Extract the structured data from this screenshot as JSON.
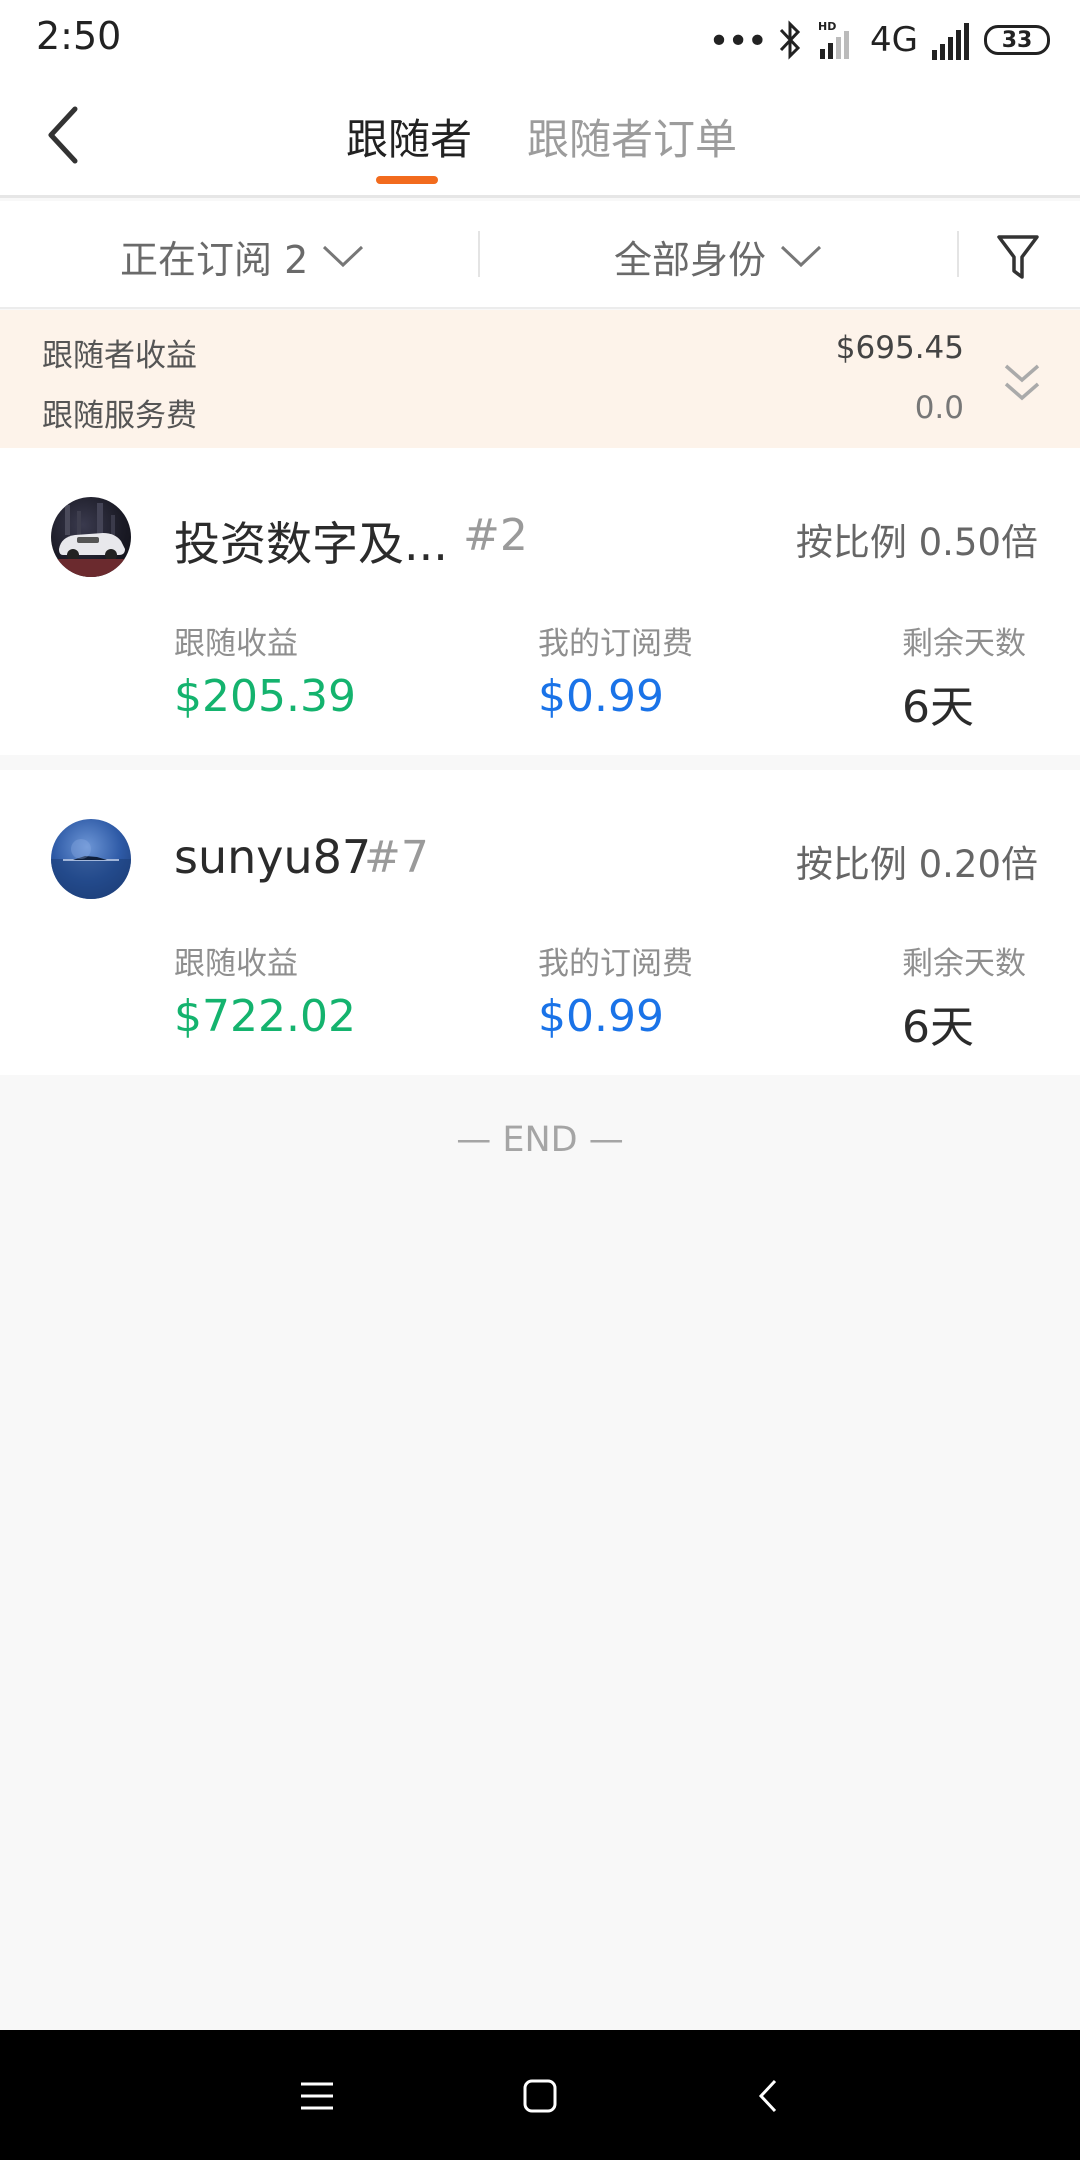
{
  "status_bar": {
    "time": "2:50",
    "network": "4G",
    "battery": "33",
    "icons": [
      "dots-icon",
      "bluetooth-icon",
      "hd-signal-icon",
      "signal-icon",
      "battery-icon"
    ]
  },
  "header": {
    "tabs": [
      {
        "label": "跟随者",
        "active": true
      },
      {
        "label": "跟随者订单",
        "active": false
      }
    ],
    "accent_color": "#f26b1d"
  },
  "filters": {
    "subscription": "正在订阅 2",
    "role": "全部身份"
  },
  "summary": {
    "earnings_label": "跟随者收益",
    "earnings_value": "$695.45",
    "fee_label": "跟随服务费",
    "fee_value": "0.0"
  },
  "followers": [
    {
      "name": "投资数字及...",
      "rank": "#2",
      "ratio": "按比例 0.50倍",
      "earnings_label": "跟随收益",
      "earnings_value": "$205.39",
      "fee_label": "我的订阅费",
      "fee_value": "$0.99",
      "days_label": "剩余天数",
      "days_value": "6天"
    },
    {
      "name": "sunyu87",
      "rank": "#7",
      "ratio": "按比例 0.20倍",
      "earnings_label": "跟随收益",
      "earnings_value": "$722.02",
      "fee_label": "我的订阅费",
      "fee_value": "$0.99",
      "days_label": "剩余天数",
      "days_value": "6天"
    }
  ],
  "end_text": "— END —",
  "colors": {
    "earnings": "#14b36e",
    "fee": "#1a73e8",
    "summary_bg": "#fdf3ea"
  }
}
